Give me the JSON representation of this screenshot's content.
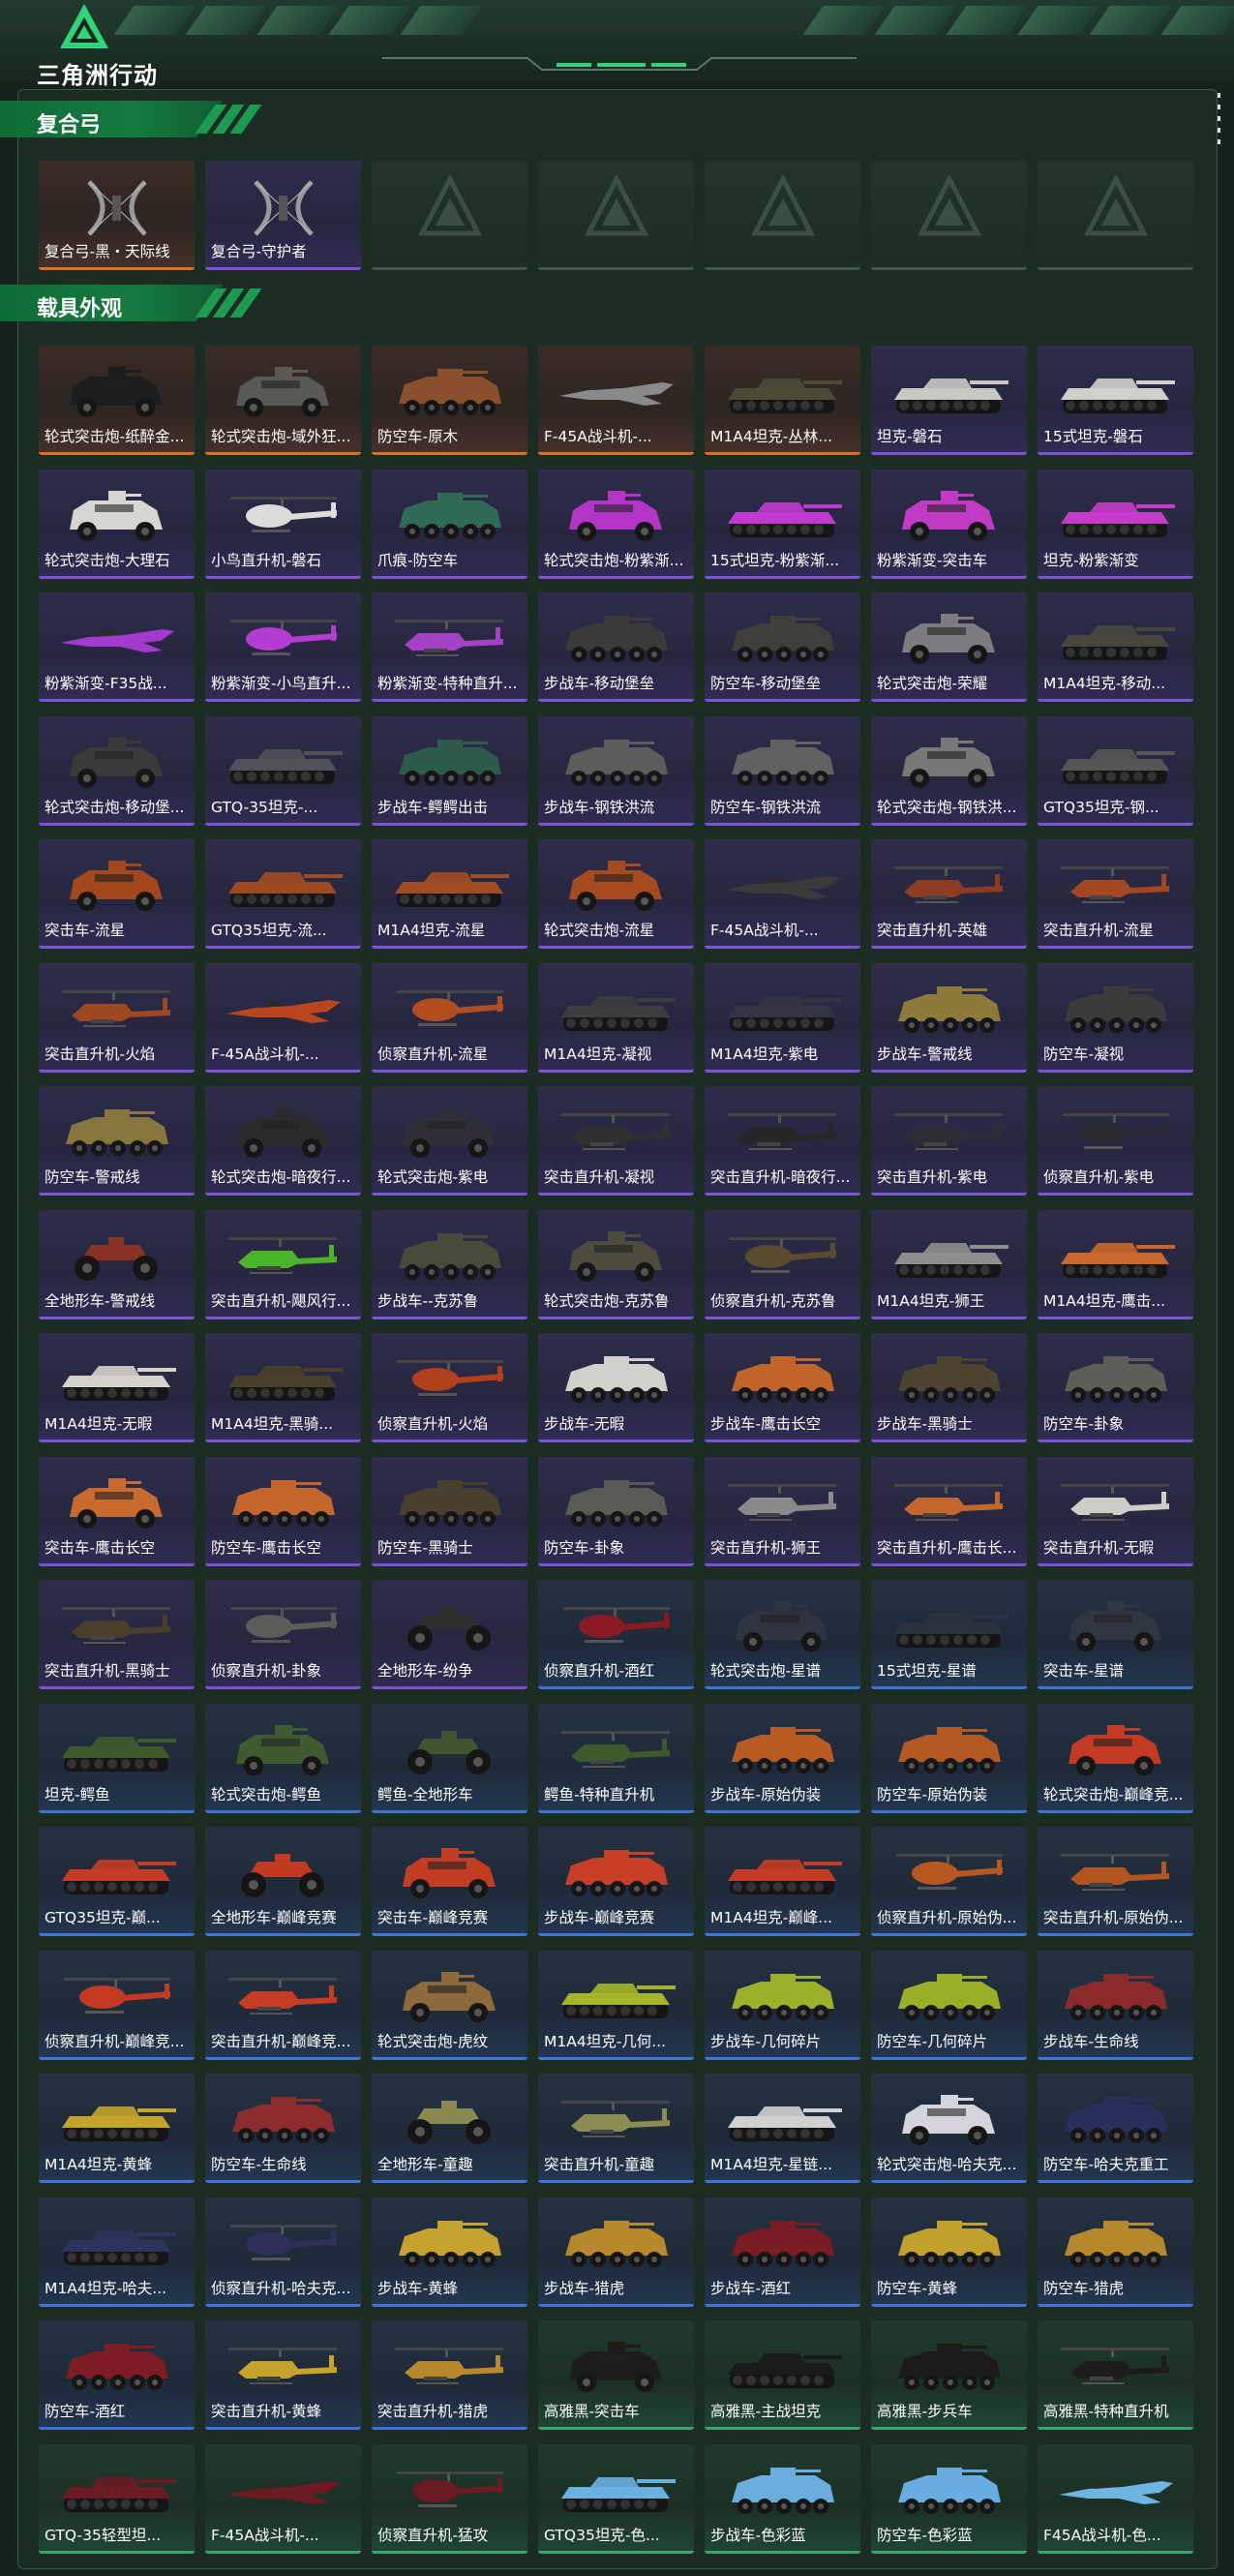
{
  "app": {
    "logo_text": "三角洲行动"
  },
  "colors": {
    "purple": "#7b52d8",
    "orange": "#d8722a",
    "blue": "#3d74d8",
    "green": "#3ea36a",
    "section": "#157a40"
  },
  "sections": [
    {
      "title": "复合弓",
      "items": [
        {
          "label": "复合弓-黑・天际线",
          "rarity": "orange",
          "icon": "bow"
        },
        {
          "label": "复合弓-守护者",
          "rarity": "purple",
          "icon": "bow"
        },
        {
          "label": "",
          "rarity": "empty",
          "icon": "empty-slot"
        },
        {
          "label": "",
          "rarity": "empty",
          "icon": "empty-slot"
        },
        {
          "label": "",
          "rarity": "empty",
          "icon": "empty-slot"
        },
        {
          "label": "",
          "rarity": "empty",
          "icon": "empty-slot"
        },
        {
          "label": "",
          "rarity": "empty",
          "icon": "empty-slot"
        }
      ]
    },
    {
      "title": "载具外观",
      "items": [
        {
          "label": "轮式突击炮-纸醉金...",
          "rarity": "orange",
          "icon": "armored-car",
          "color": "#1d1d1f"
        },
        {
          "label": "轮式突击炮-域外狂...",
          "rarity": "orange",
          "icon": "armored-car",
          "color": "#5a5852"
        },
        {
          "label": "防空车-原木",
          "rarity": "orange",
          "icon": "apc",
          "color": "#8a4f2c"
        },
        {
          "label": "F-45A战斗机-...",
          "rarity": "orange",
          "icon": "jet",
          "color": "#8a8a8a"
        },
        {
          "label": "M1A4坦克-丛林...",
          "rarity": "orange",
          "icon": "tank",
          "color": "#4b4a34"
        },
        {
          "label": "坦克-磐石",
          "rarity": "purple",
          "icon": "tank",
          "color": "#c9c9c4"
        },
        {
          "label": "15式坦克-磐石",
          "rarity": "purple",
          "icon": "tank",
          "color": "#d2d0ca"
        },
        {
          "label": "轮式突击炮-大理石",
          "rarity": "purple",
          "icon": "armored-car",
          "color": "#d8d6d0"
        },
        {
          "label": "小鸟直升机-磐石",
          "rarity": "purple",
          "icon": "helicopter",
          "color": "#dcdcdc"
        },
        {
          "label": "爪痕-防空车",
          "rarity": "purple",
          "icon": "apc",
          "color": "#2f6a55"
        },
        {
          "label": "轮式突击炮-粉紫渐...",
          "rarity": "purple",
          "icon": "armored-car",
          "color": "#b235c8"
        },
        {
          "label": "15式坦克-粉紫渐...",
          "rarity": "purple",
          "icon": "tank",
          "color": "#c03ad0"
        },
        {
          "label": "粉紫渐变-突击车",
          "rarity": "purple",
          "icon": "armored-car",
          "color": "#c23ac4"
        },
        {
          "label": "坦克-粉紫渐变",
          "rarity": "purple",
          "icon": "tank",
          "color": "#c43cc8"
        },
        {
          "label": "粉紫渐变-F35战...",
          "rarity": "purple",
          "icon": "jet",
          "color": "#a23ad0"
        },
        {
          "label": "粉紫渐变-小鸟直升...",
          "rarity": "purple",
          "icon": "helicopter",
          "color": "#b43cd0"
        },
        {
          "label": "粉紫渐变-特种直升...",
          "rarity": "purple",
          "icon": "attack-helicopter",
          "color": "#a441c6"
        },
        {
          "label": "步战车-移动堡垒",
          "rarity": "purple",
          "icon": "apc",
          "color": "#3a3a38"
        },
        {
          "label": "防空车-移动堡垒",
          "rarity": "purple",
          "icon": "apc",
          "color": "#403e3a"
        },
        {
          "label": "轮式突击炮-荣耀",
          "rarity": "purple",
          "icon": "armored-car",
          "color": "#7b7b80"
        },
        {
          "label": "M1A4坦克-移动...",
          "rarity": "purple",
          "icon": "tank",
          "color": "#48463f"
        },
        {
          "label": "轮式突击炮-移动堡...",
          "rarity": "purple",
          "icon": "armored-car",
          "color": "#3a3a3a"
        },
        {
          "label": "GTQ-35坦克-...",
          "rarity": "purple",
          "icon": "tank",
          "color": "#505056"
        },
        {
          "label": "步战车-鳄鳄出击",
          "rarity": "purple",
          "icon": "apc",
          "color": "#2d5a4a"
        },
        {
          "label": "步战车-钢铁洪流",
          "rarity": "purple",
          "icon": "apc",
          "color": "#5c5c5c"
        },
        {
          "label": "防空车-钢铁洪流",
          "rarity": "purple",
          "icon": "apc",
          "color": "#616161"
        },
        {
          "label": "轮式突击炮-钢铁洪...",
          "rarity": "purple",
          "icon": "armored-car",
          "color": "#777"
        },
        {
          "label": "GTQ35坦克-钢...",
          "rarity": "purple",
          "icon": "tank",
          "color": "#555"
        },
        {
          "label": "突击车-流星",
          "rarity": "purple",
          "icon": "armored-car",
          "color": "#a3471c"
        },
        {
          "label": "GTQ35坦克-流...",
          "rarity": "purple",
          "icon": "tank",
          "color": "#9e4a20"
        },
        {
          "label": "M1A4坦克-流星",
          "rarity": "purple",
          "icon": "tank",
          "color": "#a24c22"
        },
        {
          "label": "轮式突击炮-流星",
          "rarity": "purple",
          "icon": "armored-car",
          "color": "#a64b1f"
        },
        {
          "label": "F-45A战斗机-...",
          "rarity": "purple",
          "icon": "jet",
          "color": "#3a3a3a"
        },
        {
          "label": "突击直升机-英雄",
          "rarity": "purple",
          "icon": "attack-helicopter",
          "color": "#8d3a22"
        },
        {
          "label": "突击直升机-流星",
          "rarity": "purple",
          "icon": "attack-helicopter",
          "color": "#a4461f"
        },
        {
          "label": "突击直升机-火焰",
          "rarity": "purple",
          "icon": "attack-helicopter",
          "color": "#9c4820"
        },
        {
          "label": "F-45A战斗机-...",
          "rarity": "purple",
          "icon": "jet",
          "color": "#b8451c"
        },
        {
          "label": "侦察直升机-流星",
          "rarity": "purple",
          "icon": "helicopter",
          "color": "#b14d1e"
        },
        {
          "label": "M1A4坦克-凝视",
          "rarity": "purple",
          "icon": "tank",
          "color": "#3d3d3f"
        },
        {
          "label": "M1A4坦克-紫电",
          "rarity": "purple",
          "icon": "tank",
          "color": "#343440"
        },
        {
          "label": "步战车-警戒线",
          "rarity": "purple",
          "icon": "apc",
          "color": "#8c7a3a"
        },
        {
          "label": "防空车-凝视",
          "rarity": "purple",
          "icon": "apc",
          "color": "#3b3b3b"
        },
        {
          "label": "防空车-警戒线",
          "rarity": "purple",
          "icon": "apc",
          "color": "#86763e"
        },
        {
          "label": "轮式突击炮-暗夜行...",
          "rarity": "purple",
          "icon": "armored-car",
          "color": "#2b2b2e"
        },
        {
          "label": "轮式突击炮-紫电",
          "rarity": "purple",
          "icon": "armored-car",
          "color": "#2e2e36"
        },
        {
          "label": "突击直升机-凝视",
          "rarity": "purple",
          "icon": "attack-helicopter",
          "color": "#303032"
        },
        {
          "label": "突击直升机-暗夜行...",
          "rarity": "purple",
          "icon": "attack-helicopter",
          "color": "#262628"
        },
        {
          "label": "突击直升机-紫电",
          "rarity": "purple",
          "icon": "attack-helicopter",
          "color": "#2c2c34"
        },
        {
          "label": "侦察直升机-紫电",
          "rarity": "purple",
          "icon": "helicopter",
          "color": "#2a2a30"
        },
        {
          "label": "全地形车-警戒线",
          "rarity": "purple",
          "icon": "atv",
          "color": "#8a3324"
        },
        {
          "label": "突击直升机-飓风行...",
          "rarity": "purple",
          "icon": "attack-helicopter",
          "color": "#4bb52a"
        },
        {
          "label": "步战车--克苏鲁",
          "rarity": "purple",
          "icon": "apc",
          "color": "#4a4a3c"
        },
        {
          "label": "轮式突击炮-克苏鲁",
          "rarity": "purple",
          "icon": "armored-car",
          "color": "#4c4b3d"
        },
        {
          "label": "侦察直升机-克苏鲁",
          "rarity": "purple",
          "icon": "helicopter",
          "color": "#5a4a30"
        },
        {
          "label": "M1A4坦克-狮王",
          "rarity": "purple",
          "icon": "tank",
          "color": "#8e8e8e"
        },
        {
          "label": "M1A4坦克-鹰击...",
          "rarity": "purple",
          "icon": "tank",
          "color": "#c9682a"
        },
        {
          "label": "M1A4坦克-无暇",
          "rarity": "purple",
          "icon": "tank",
          "color": "#d5d3cc"
        },
        {
          "label": "M1A4坦克-黑骑...",
          "rarity": "purple",
          "icon": "tank",
          "color": "#4a3f2a"
        },
        {
          "label": "侦察直升机-火焰",
          "rarity": "purple",
          "icon": "helicopter",
          "color": "#b2401c"
        },
        {
          "label": "步战车-无暇",
          "rarity": "purple",
          "icon": "apc",
          "color": "#d2d0cb"
        },
        {
          "label": "步战车-鹰击长空",
          "rarity": "purple",
          "icon": "apc",
          "color": "#c0642a"
        },
        {
          "label": "步战车-黑骑士",
          "rarity": "purple",
          "icon": "apc",
          "color": "#4c4230"
        },
        {
          "label": "防空车-卦象",
          "rarity": "purple",
          "icon": "apc",
          "color": "#5e5e58"
        },
        {
          "label": "突击车-鹰击长空",
          "rarity": "purple",
          "icon": "armored-car",
          "color": "#c86a2c"
        },
        {
          "label": "防空车-鹰击长空",
          "rarity": "purple",
          "icon": "apc",
          "color": "#c4662a"
        },
        {
          "label": "防空车-黑骑士",
          "rarity": "purple",
          "icon": "apc",
          "color": "#483f2c"
        },
        {
          "label": "防空车-卦象",
          "rarity": "purple",
          "icon": "apc",
          "color": "#5a5a55"
        },
        {
          "label": "突击直升机-狮王",
          "rarity": "purple",
          "icon": "attack-helicopter",
          "color": "#8a8a8a"
        },
        {
          "label": "突击直升机-鹰击长...",
          "rarity": "purple",
          "icon": "attack-helicopter",
          "color": "#c4652a"
        },
        {
          "label": "突击直升机-无暇",
          "rarity": "purple",
          "icon": "attack-helicopter",
          "color": "#cfcdc7"
        },
        {
          "label": "突击直升机-黑骑士",
          "rarity": "purple",
          "icon": "attack-helicopter",
          "color": "#4a3f2b"
        },
        {
          "label": "侦察直升机-卦象",
          "rarity": "purple",
          "icon": "helicopter",
          "color": "#5c5c58"
        },
        {
          "label": "全地形车-纷争",
          "rarity": "purple",
          "icon": "atv",
          "color": "#2c2c2c"
        },
        {
          "label": "侦察直升机-酒红",
          "rarity": "blue",
          "icon": "helicopter",
          "color": "#8a1a22"
        },
        {
          "label": "轮式突击炮-星谱",
          "rarity": "blue",
          "icon": "armored-car",
          "color": "#2e3440"
        },
        {
          "label": "15式坦克-星谱",
          "rarity": "blue",
          "icon": "tank",
          "color": "#2c323d"
        },
        {
          "label": "突击车-星谱",
          "rarity": "blue",
          "icon": "armored-car",
          "color": "#30363f"
        },
        {
          "label": "坦克-鳄鱼",
          "rarity": "blue",
          "icon": "tank",
          "color": "#3e5a2c"
        },
        {
          "label": "轮式突击炮-鳄鱼",
          "rarity": "blue",
          "icon": "armored-car",
          "color": "#3f5a2e"
        },
        {
          "label": "鳄鱼-全地形车",
          "rarity": "blue",
          "icon": "atv",
          "color": "#3f5530"
        },
        {
          "label": "鳄鱼-特种直升机",
          "rarity": "blue",
          "icon": "attack-helicopter",
          "color": "#3d5a2d"
        },
        {
          "label": "步战车-原始伪装",
          "rarity": "blue",
          "icon": "apc",
          "color": "#b85a22"
        },
        {
          "label": "防空车-原始伪装",
          "rarity": "blue",
          "icon": "apc",
          "color": "#b45822"
        },
        {
          "label": "轮式突击炮-巅峰竞...",
          "rarity": "blue",
          "icon": "armored-car",
          "color": "#c23a22"
        },
        {
          "label": "GTQ35坦克-巅...",
          "rarity": "blue",
          "icon": "tank",
          "color": "#c43c24"
        },
        {
          "label": "全地形车-巅峰竞赛",
          "rarity": "blue",
          "icon": "atv",
          "color": "#c03a22"
        },
        {
          "label": "突击车-巅峰竞赛",
          "rarity": "blue",
          "icon": "armored-car",
          "color": "#c23c24"
        },
        {
          "label": "步战车-巅峰竞赛",
          "rarity": "blue",
          "icon": "apc",
          "color": "#c63e26"
        },
        {
          "label": "M1A4坦克-巅峰...",
          "rarity": "blue",
          "icon": "tank",
          "color": "#c43c24"
        },
        {
          "label": "侦察直升机-原始伪...",
          "rarity": "blue",
          "icon": "helicopter",
          "color": "#b8561f"
        },
        {
          "label": "突击直升机-原始伪...",
          "rarity": "blue",
          "icon": "attack-helicopter",
          "color": "#b25420"
        },
        {
          "label": "侦察直升机-巅峰竞...",
          "rarity": "blue",
          "icon": "helicopter",
          "color": "#c23a22"
        },
        {
          "label": "突击直升机-巅峰竞...",
          "rarity": "blue",
          "icon": "attack-helicopter",
          "color": "#c43c24"
        },
        {
          "label": "轮式突击炮-虎纹",
          "rarity": "blue",
          "icon": "armored-car",
          "color": "#8c6a3c"
        },
        {
          "label": "M1A4坦克-几何...",
          "rarity": "blue",
          "icon": "tank",
          "color": "#a4b628"
        },
        {
          "label": "步战车-几何碎片",
          "rarity": "blue",
          "icon": "apc",
          "color": "#9cb02a"
        },
        {
          "label": "防空车-几何碎片",
          "rarity": "blue",
          "icon": "apc",
          "color": "#9aae28"
        },
        {
          "label": "步战车-生命线",
          "rarity": "blue",
          "icon": "apc",
          "color": "#8a2a2a"
        },
        {
          "label": "M1A4坦克-黄蜂",
          "rarity": "blue",
          "icon": "tank",
          "color": "#c4a42a"
        },
        {
          "label": "防空车-生命线",
          "rarity": "blue",
          "icon": "apc",
          "color": "#8c2c2c"
        },
        {
          "label": "全地形车-童趣",
          "rarity": "blue",
          "icon": "atv",
          "color": "#8a8a50"
        },
        {
          "label": "突击直升机-童趣",
          "rarity": "blue",
          "icon": "attack-helicopter",
          "color": "#8c8c52"
        },
        {
          "label": "M1A4坦克-星链...",
          "rarity": "blue",
          "icon": "tank",
          "color": "#d0d0d0"
        },
        {
          "label": "轮式突击炮-哈夫克...",
          "rarity": "blue",
          "icon": "armored-car",
          "color": "#d4d4dc"
        },
        {
          "label": "防空车-哈夫克重工",
          "rarity": "blue",
          "icon": "apc",
          "color": "#2a2e5a"
        },
        {
          "label": "M1A4坦克-哈夫...",
          "rarity": "blue",
          "icon": "tank",
          "color": "#2e325c"
        },
        {
          "label": "侦察直升机-哈夫克...",
          "rarity": "blue",
          "icon": "helicopter",
          "color": "#2c305a"
        },
        {
          "label": "步战车-黄蜂",
          "rarity": "blue",
          "icon": "apc",
          "color": "#c4a22c"
        },
        {
          "label": "步战车-猎虎",
          "rarity": "blue",
          "icon": "apc",
          "color": "#b8892c"
        },
        {
          "label": "步战车-酒红",
          "rarity": "blue",
          "icon": "apc",
          "color": "#7a1c24"
        },
        {
          "label": "防空车-黄蜂",
          "rarity": "blue",
          "icon": "apc",
          "color": "#c2a02c"
        },
        {
          "label": "防空车-猎虎",
          "rarity": "blue",
          "icon": "apc",
          "color": "#b6882c"
        },
        {
          "label": "防空车-酒红",
          "rarity": "blue",
          "icon": "apc",
          "color": "#7c1c24"
        },
        {
          "label": "突击直升机-黄蜂",
          "rarity": "blue",
          "icon": "attack-helicopter",
          "color": "#c6a42c"
        },
        {
          "label": "突击直升机-猎虎",
          "rarity": "blue",
          "icon": "attack-helicopter",
          "color": "#b8892c"
        },
        {
          "label": "高雅黑-突击车",
          "rarity": "green",
          "icon": "armored-car",
          "color": "#1c1c1c"
        },
        {
          "label": "高雅黑-主战坦克",
          "rarity": "green",
          "icon": "tank",
          "color": "#1a1a1a"
        },
        {
          "label": "高雅黑-步兵车",
          "rarity": "green",
          "icon": "apc",
          "color": "#1b1b1b"
        },
        {
          "label": "高雅黑-特种直升机",
          "rarity": "green",
          "icon": "attack-helicopter",
          "color": "#1c1c1c"
        },
        {
          "label": "GTQ-35轻型坦...",
          "rarity": "green",
          "icon": "tank",
          "color": "#6a1a22"
        },
        {
          "label": "F-45A战斗机-...",
          "rarity": "green",
          "icon": "jet",
          "color": "#6c1a22"
        },
        {
          "label": "侦察直升机-猛攻",
          "rarity": "green",
          "icon": "helicopter",
          "color": "#6a1a22"
        },
        {
          "label": "GTQ35坦克-色...",
          "rarity": "green",
          "icon": "tank",
          "color": "#6ab0e0"
        },
        {
          "label": "步战车-色彩蓝",
          "rarity": "green",
          "icon": "apc",
          "color": "#6aaee0"
        },
        {
          "label": "防空车-色彩蓝",
          "rarity": "green",
          "icon": "apc",
          "color": "#68ace0"
        },
        {
          "label": "F45A战斗机-色...",
          "rarity": "green",
          "icon": "jet",
          "color": "#70b4e2"
        }
      ]
    }
  ]
}
